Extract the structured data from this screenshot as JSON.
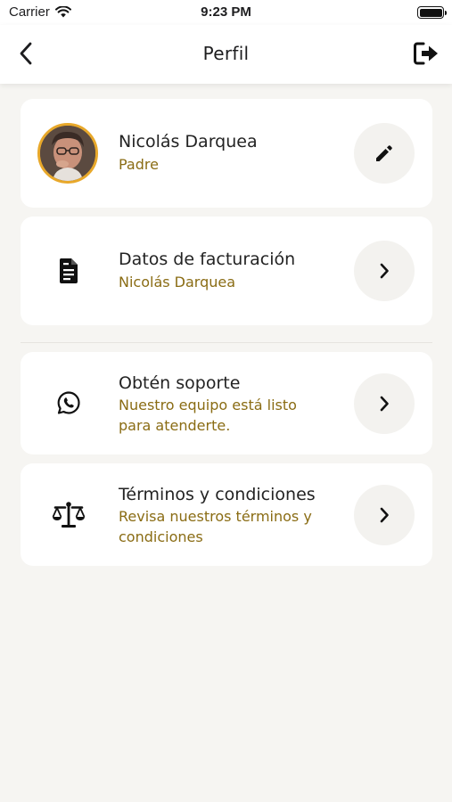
{
  "status_bar": {
    "carrier": "Carrier",
    "time": "9:23 PM"
  },
  "nav": {
    "title": "Perfil",
    "back_icon": "chevron-left-icon",
    "logout_icon": "logout-icon"
  },
  "profile": {
    "name": "Nicolás Darquea",
    "role": "Padre",
    "edit_icon": "pencil-icon"
  },
  "menu": [
    {
      "title": "Datos de facturación",
      "subtitle_lines": [
        "Nicolás  Darquea"
      ],
      "icon": "document-icon"
    },
    {
      "title": "Obtén soporte",
      "subtitle_lines": [
        "Nuestro equipo está listo",
        "para atenderte."
      ],
      "icon": "whatsapp-icon"
    },
    {
      "title": "Términos y condiciones",
      "subtitle_lines": [
        "Revisa nuestros términos y",
        "condiciones"
      ],
      "icon": "scale-icon"
    }
  ],
  "colors": {
    "accent": "#8a6c14",
    "avatar_ring": "#e8a82a",
    "background": "#f6f5f2"
  }
}
